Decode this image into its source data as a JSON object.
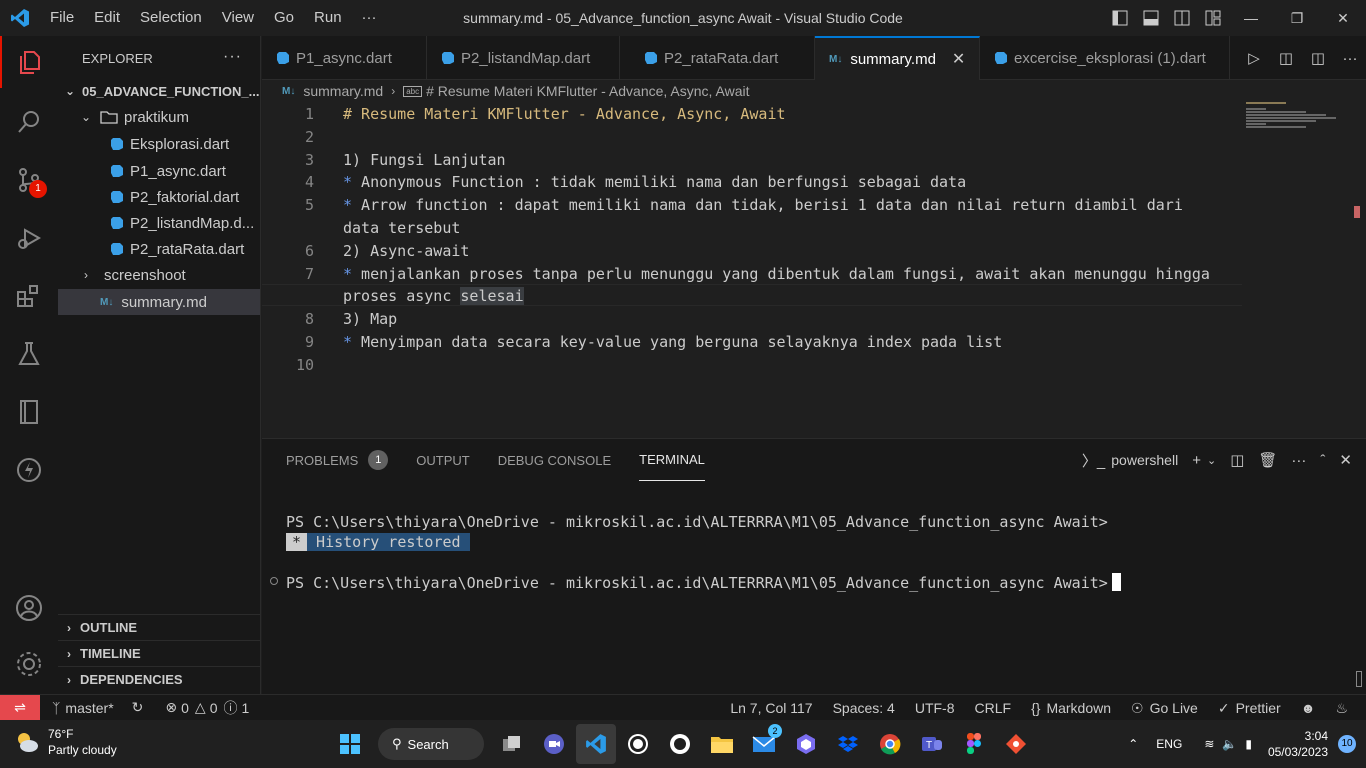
{
  "window": {
    "title": "summary.md - 05_Advance_function_async Await - Visual Studio Code",
    "menu": [
      "File",
      "Edit",
      "Selection",
      "View",
      "Go",
      "Run",
      "···"
    ]
  },
  "activity": {
    "scm_badge": "1"
  },
  "explorer": {
    "header": "EXPLORER",
    "more": "···",
    "root": "05_ADVANCE_FUNCTION_...",
    "folders": {
      "praktikum": "praktikum",
      "screenshoot": "screenshoot"
    },
    "files": [
      "Eksplorasi.dart",
      "P1_async.dart",
      "P2_faktorial.dart",
      "P2_listandMap.d...",
      "P2_rataRata.dart"
    ],
    "summary": "summary.md",
    "sections": [
      "OUTLINE",
      "TIMELINE",
      "DEPENDENCIES"
    ]
  },
  "tabs": [
    {
      "label": "P1_async.dart"
    },
    {
      "label": "P2_listandMap.dart"
    },
    {
      "label": "P2_rataRata.dart"
    },
    {
      "label": "summary.md"
    },
    {
      "label": "excercise_eksplorasi (1).dart"
    }
  ],
  "breadcrumb": {
    "file": "summary.md",
    "symbol": "# Resume Materi KMFlutter - Advance, Async, Await"
  },
  "editor": {
    "line_numbers": [
      "1",
      "2",
      "3",
      "4",
      "5",
      "",
      "6",
      "7",
      "",
      "8",
      "9",
      "10"
    ],
    "l1": "# Resume Materi KMFlutter - Advance, Async, Await",
    "l3_num": "1)",
    "l3": " Fungsi Lanjutan",
    "l4_b": "*",
    "l4": " Anonymous Function : tidak memiliki nama dan berfungsi sebagai data",
    "l5_b": "*",
    "l5": " Arrow function : dapat memiliki nama dan tidak, berisi 1 data dan nilai return diambil dari",
    "l5b": "data tersebut",
    "l6_num": "2)",
    "l6": " Async-await",
    "l7_b": "*",
    "l7": " menjalankan proses tanpa perlu menunggu yang dibentuk dalam fungsi, await akan menunggu hingga",
    "l7b_a": "proses async ",
    "l7b_sel": "selesai",
    "l8_num": "3)",
    "l8": " Map",
    "l9_b": "*",
    "l9": " Menyimpan data secara key-value yang berguna selayaknya index pada list"
  },
  "panel": {
    "tabs": [
      "PROBLEMS",
      "OUTPUT",
      "DEBUG CONSOLE",
      "TERMINAL"
    ],
    "problems_count": "1",
    "shell": "powershell",
    "prompt1": "PS C:\\Users\\thiyara\\OneDrive - mikroskil.ac.id\\ALTERRRA\\M1\\05_Advance_function_async Await>",
    "restored_star": "*",
    "restored": " History restored ",
    "prompt2": "PS C:\\Users\\thiyara\\OneDrive - mikroskil.ac.id\\ALTERRRA\\M1\\05_Advance_function_async Await>"
  },
  "status": {
    "branch": "master*",
    "errors": "0",
    "warnings": "0",
    "info": "1",
    "position": "Ln 7, Col 117",
    "spaces": "Spaces: 4",
    "encoding": "UTF-8",
    "eol": "CRLF",
    "language": "Markdown",
    "golive": "Go Live",
    "prettier": "Prettier"
  },
  "taskbar": {
    "temp": "76°F",
    "weather": "Partly cloudy",
    "search": "Search",
    "lang": "ENG",
    "time": "3:04",
    "date": "05/03/2023",
    "notifications": "10",
    "teams_badge": "2"
  },
  "colors": {
    "accent": "#0078d4",
    "error_badge": "#e51400",
    "remote": "#e5484d",
    "heading": "#d7ba7d",
    "bullet": "#6796e6"
  }
}
